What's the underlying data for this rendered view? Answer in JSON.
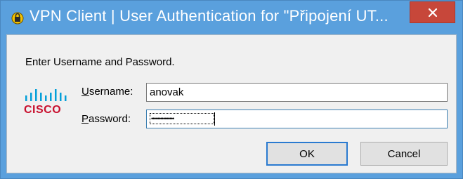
{
  "window": {
    "title": "VPN Client  |  User Authentication for \"Připojení UT...",
    "close_icon": "close-icon",
    "app_icon": "vpn-lock-icon"
  },
  "dialog": {
    "prompt": "Enter Username and Password.",
    "logo_text": "CISCO",
    "username": {
      "label_accel": "U",
      "label_rest": "sername:",
      "value": "anovak"
    },
    "password": {
      "label_accel": "P",
      "label_rest": "assword:",
      "masked_value": "•••••••••••••••"
    },
    "buttons": {
      "ok": "OK",
      "cancel": "Cancel"
    }
  },
  "colors": {
    "titlebar": "#5aa0dd",
    "close_button": "#c7473a",
    "client_bg": "#f0f0f0",
    "cisco_red": "#c8102e",
    "cisco_blue": "#049fd9"
  }
}
